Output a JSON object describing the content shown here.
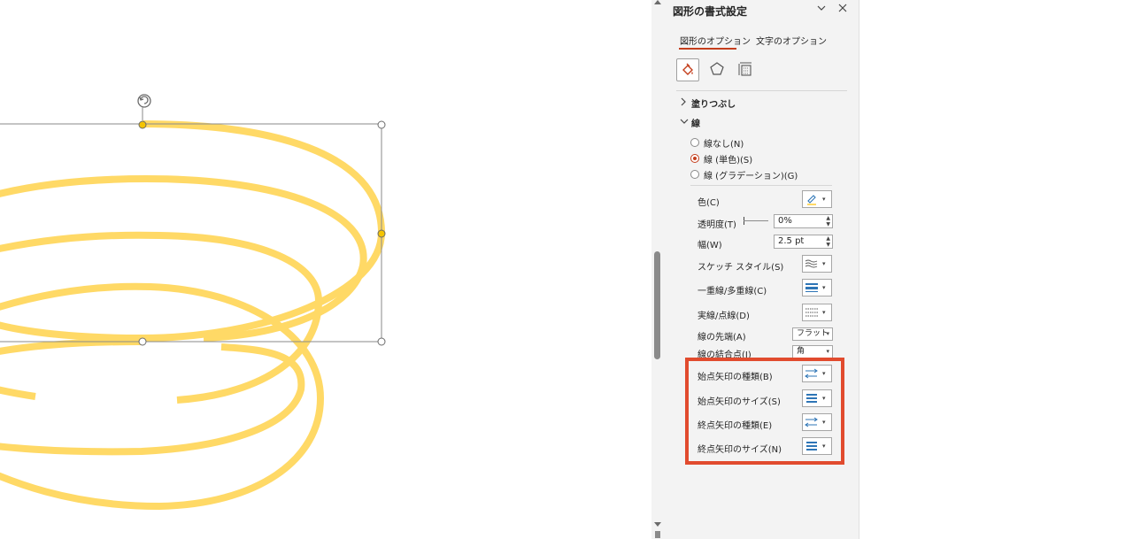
{
  "pane": {
    "title": "図形の書式設定",
    "collapse_icon": "chevron-down-icon",
    "close_icon": "close-icon",
    "tabs": [
      {
        "label": "図形のオプション",
        "active": true
      },
      {
        "label": "文字のオプション",
        "active": false
      }
    ],
    "category_icons": [
      "fill-line-icon",
      "effects-pentagon-icon",
      "size-properties-icon"
    ],
    "sections": {
      "fill": "塗りつぶし",
      "line": "線"
    },
    "line_type_options": [
      {
        "label": "線なし(N)",
        "selected": false
      },
      {
        "label": "線 (単色)(S)",
        "selected": true
      },
      {
        "label": "線 (グラデーション)(G)",
        "selected": false
      }
    ],
    "color_label": "色(C)",
    "transparency_label": "透明度(T)",
    "transparency_value": "0%",
    "width_label": "幅(W)",
    "width_value": "2.5 pt",
    "sketch_label": "スケッチ スタイル(S)",
    "compound_label": "一重線/多重線(C)",
    "dash_label": "実線/点線(D)",
    "cap_label": "線の先端(A)",
    "cap_value": "フラット",
    "join_label": "線の結合点(J)",
    "join_value": "角",
    "begin_arrow_type_label": "始点矢印の種類(B)",
    "begin_arrow_size_label": "始点矢印のサイズ(S)",
    "end_arrow_type_label": "終点矢印の種類(E)",
    "end_arrow_size_label": "終点矢印のサイズ(N)"
  },
  "colors": {
    "accent": "#c43e1c",
    "highlight_box": "#e14b2e",
    "spiral_stroke": "#ffd966",
    "handle_yellow": "#f5c400",
    "icon_blue": "#2e75b6"
  }
}
